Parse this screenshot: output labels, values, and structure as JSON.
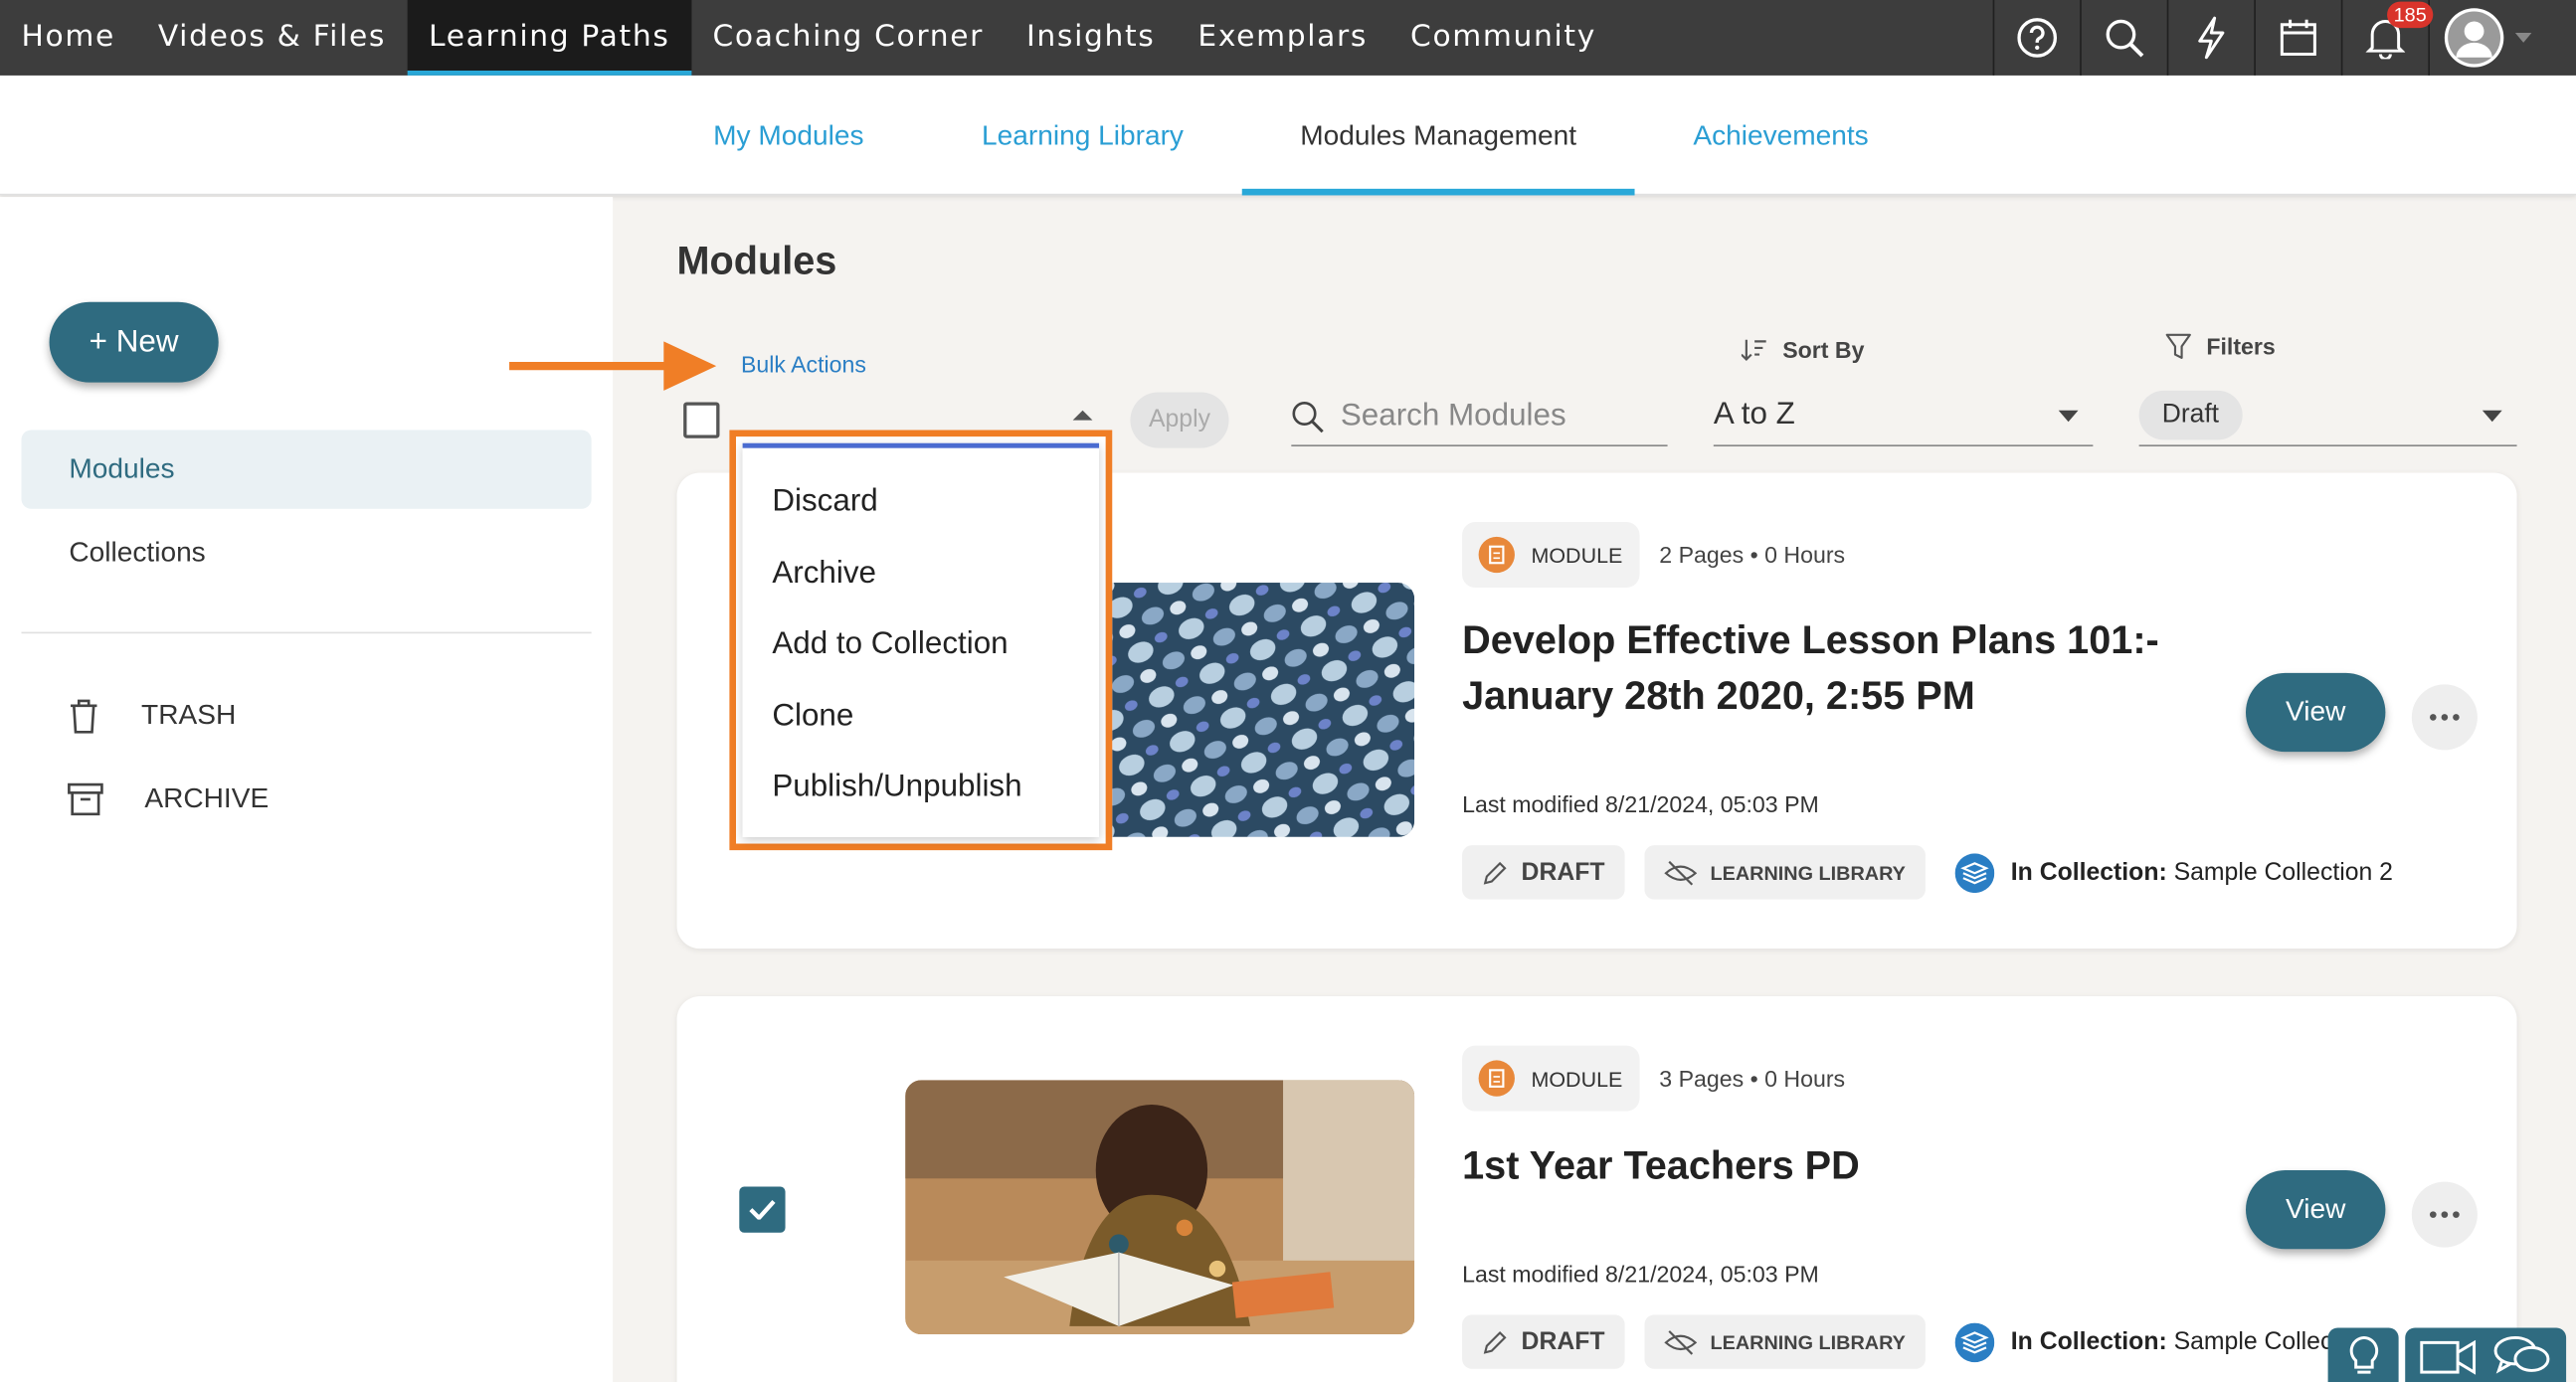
{
  "topnav": {
    "items": [
      "Home",
      "Videos & Files",
      "Learning Paths",
      "Coaching Corner",
      "Insights",
      "Exemplars",
      "Community"
    ],
    "active": "Learning Paths",
    "icons": [
      "help-icon",
      "search-icon",
      "lightning-icon",
      "calendar-icon",
      "bell-icon",
      "avatar"
    ],
    "notification_count": "185"
  },
  "subnav": {
    "tabs": [
      "My Modules",
      "Learning Library",
      "Modules Management",
      "Achievements"
    ],
    "active": "Modules Management"
  },
  "sidebar": {
    "new_button": "+ New",
    "items": [
      "Modules",
      "Collections"
    ],
    "active": "Modules",
    "utilities": [
      {
        "label": "TRASH",
        "icon": "trash-icon"
      },
      {
        "label": "ARCHIVE",
        "icon": "archive-icon"
      }
    ]
  },
  "main": {
    "title": "Modules",
    "bulk_actions_label": "Bulk Actions",
    "apply_label": "Apply",
    "search_placeholder": "Search Modules",
    "sort_label": "Sort By",
    "sort_value": "A to Z",
    "filters_label": "Filters",
    "filter_chip": "Draft",
    "bulk_menu": [
      "Discard",
      "Archive",
      "Add to Collection",
      "Clone",
      "Publish/Unpublish"
    ]
  },
  "cards": [
    {
      "type": "MODULE",
      "meta": "2 Pages • 0 Hours",
      "title": "Develop Effective Lesson Plans 101:- January 28th 2020, 2:55 PM",
      "modified": "Last modified 8/21/2024, 05:03 PM",
      "status": "DRAFT",
      "visibility": "LEARNING LIBRARY",
      "collection_label": "In Collection:",
      "collection_value": "Sample Collection 2",
      "view_label": "View",
      "checked": false
    },
    {
      "type": "MODULE",
      "meta": "3 Pages • 0 Hours",
      "title": "1st Year Teachers PD",
      "modified": "Last modified 8/21/2024, 05:03 PM",
      "status": "DRAFT",
      "visibility": "LEARNING LIBRARY",
      "collection_label": "In Collection:",
      "collection_value": "Sample Collect",
      "view_label": "View",
      "checked": true
    }
  ],
  "colors": {
    "topnav_bg": "#3d3d3d",
    "accent": "#2f6b80",
    "link": "#2a9ed4",
    "highlight": "#f07e26",
    "badge": "#d9342b"
  }
}
